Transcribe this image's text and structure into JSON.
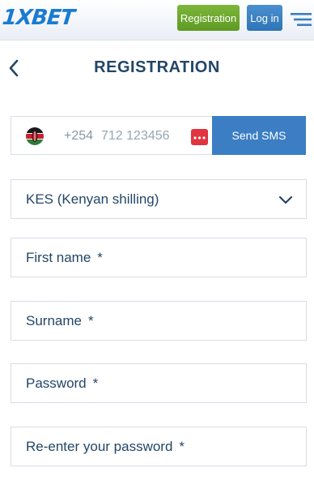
{
  "header": {
    "logo": "1XBET",
    "register_label": "Registration",
    "login_label": "Log in",
    "menu_icon": "hamburger-menu-icon"
  },
  "page": {
    "back_icon": "chevron-left-icon",
    "title": "REGISTRATION"
  },
  "phone": {
    "country_flag": "kenya-flag-icon",
    "code": "+254",
    "placeholder": "712 123456",
    "dots_icon": "ellipsis-icon",
    "send_sms_label": "Send SMS"
  },
  "currency": {
    "selected": "KES (Kenyan shilling)",
    "chevron_icon": "chevron-down-icon"
  },
  "fields": {
    "first_name": "First name",
    "surname": "Surname",
    "password": "Password",
    "reenter_password": "Re-enter your password",
    "required_mark": "*"
  },
  "colors": {
    "brand_blue": "#1a7bd1",
    "register_green": "#6aa82c",
    "login_blue": "#3f86c8",
    "sms_blue": "#3b7ec3",
    "title_navy": "#244667",
    "dots_red": "#e0343f"
  }
}
